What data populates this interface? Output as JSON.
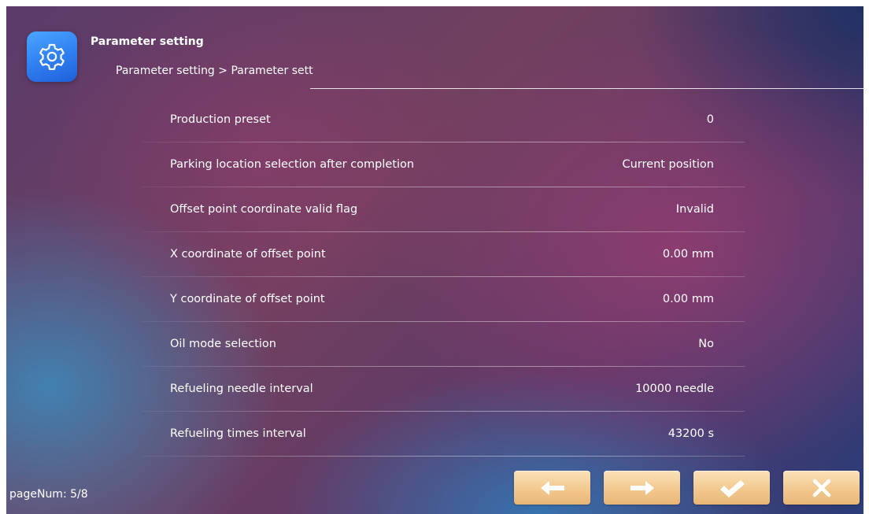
{
  "header": {
    "title": "Parameter setting",
    "breadcrumb": "Parameter setting > Parameter setting",
    "icon": "gear-icon"
  },
  "params": [
    {
      "label": "Production preset",
      "value": "0"
    },
    {
      "label": "Parking location selection after completion",
      "value": "Current position"
    },
    {
      "label": "Offset point coordinate valid flag",
      "value": "Invalid"
    },
    {
      "label": "X coordinate of offset point",
      "value": "0.00 mm"
    },
    {
      "label": "Y coordinate of offset point",
      "value": "0.00 mm"
    },
    {
      "label": "Oil mode selection",
      "value": "No"
    },
    {
      "label": "Refueling needle interval",
      "value": "10000 needle"
    },
    {
      "label": "Refueling times interval",
      "value": "43200 s"
    }
  ],
  "footer": {
    "page_num": "pageNum: 5/8",
    "buttons": [
      {
        "name": "previous-page-button",
        "icon": "arrow-left-icon"
      },
      {
        "name": "next-page-button",
        "icon": "arrow-right-icon"
      },
      {
        "name": "confirm-button",
        "icon": "checkmark-icon"
      },
      {
        "name": "close-button",
        "icon": "close-icon"
      }
    ]
  },
  "colors": {
    "button_face": "#f2c98f",
    "icon_tile": "#2f7ef0"
  }
}
